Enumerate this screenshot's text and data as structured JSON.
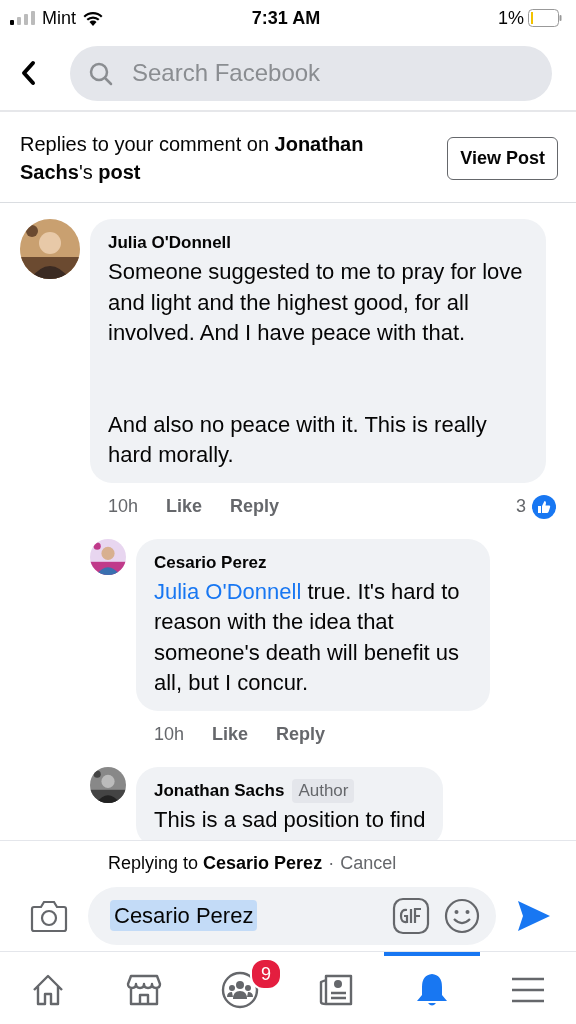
{
  "status_bar": {
    "carrier": "Mint",
    "time": "7:31 AM",
    "battery": "1%"
  },
  "header": {
    "search": {
      "placeholder": "Search Facebook"
    }
  },
  "banner": {
    "text": "Replies to your comment on **Jonathan Sachs**'s **post**",
    "button": "View Post"
  },
  "comments": [
    {
      "author": "Julia O'Donnell",
      "text": "Someone suggested to me to pray for love and light and the highest good, for all involved. And I have peace with that.\n\n\nAnd also no peace with it. This is really hard morally.",
      "time": "10h",
      "actions": [
        "Like",
        "Reply"
      ],
      "likes": "3",
      "children": [
        {
          "author": "Cesario Perez",
          "mention": "Julia O'Donnell",
          "text": " true. It's hard to reason with the idea that someone's death will benefit us all, but I concur.",
          "time": "10h",
          "actions": [
            "Like",
            "Reply"
          ]
        },
        {
          "author": "Jonathan Sachs",
          "badge": "Author",
          "text": "This is a sad position to find"
        }
      ]
    }
  ],
  "composer": {
    "replying": "Replying to **Cesario Perez**",
    "separator": "·",
    "cancel": "Cancel",
    "value": "Cesario Perez"
  },
  "tabs": [
    {
      "kind": "home",
      "selected": false
    },
    {
      "kind": "marketplace",
      "selected": false
    },
    {
      "kind": "groups",
      "selected": false,
      "badge": "9"
    },
    {
      "kind": "news",
      "selected": false
    },
    {
      "kind": "notifications",
      "selected": true
    },
    {
      "kind": "menu",
      "selected": false
    }
  ]
}
